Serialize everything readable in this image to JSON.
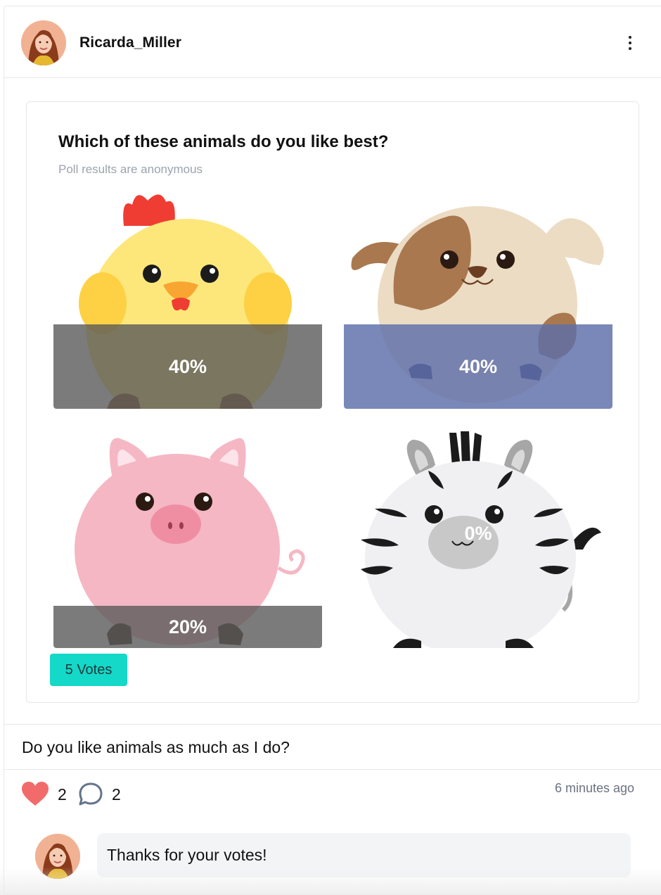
{
  "post": {
    "username": "Ricarda_Miller",
    "caption": "Do you like animals as much as I do?",
    "time": "6 minutes ago"
  },
  "poll": {
    "question": "Which of these animals do you like best?",
    "subtitle": "Poll results are anonymous",
    "options": [
      {
        "animal": "chick",
        "percent_label": "40%",
        "percent": 40,
        "selected": false
      },
      {
        "animal": "puppy",
        "percent_label": "40%",
        "percent": 40,
        "selected": true
      },
      {
        "animal": "pig",
        "percent_label": "20%",
        "percent": 20,
        "selected": false
      },
      {
        "animal": "zebra",
        "percent_label": "0%",
        "percent": 0,
        "selected": false
      }
    ],
    "votes_label": "5 Votes"
  },
  "reactions": {
    "likes": "2",
    "comments": "2"
  },
  "comment": {
    "text": "Thanks for your votes!"
  },
  "colors": {
    "accent": "#14d8c8",
    "selected_bar": "#5d6eaa",
    "bar": "#5a5a5a",
    "heart": "#f26b6b"
  },
  "icons": [
    "more-vertical-icon",
    "heart-icon",
    "comment-icon"
  ]
}
